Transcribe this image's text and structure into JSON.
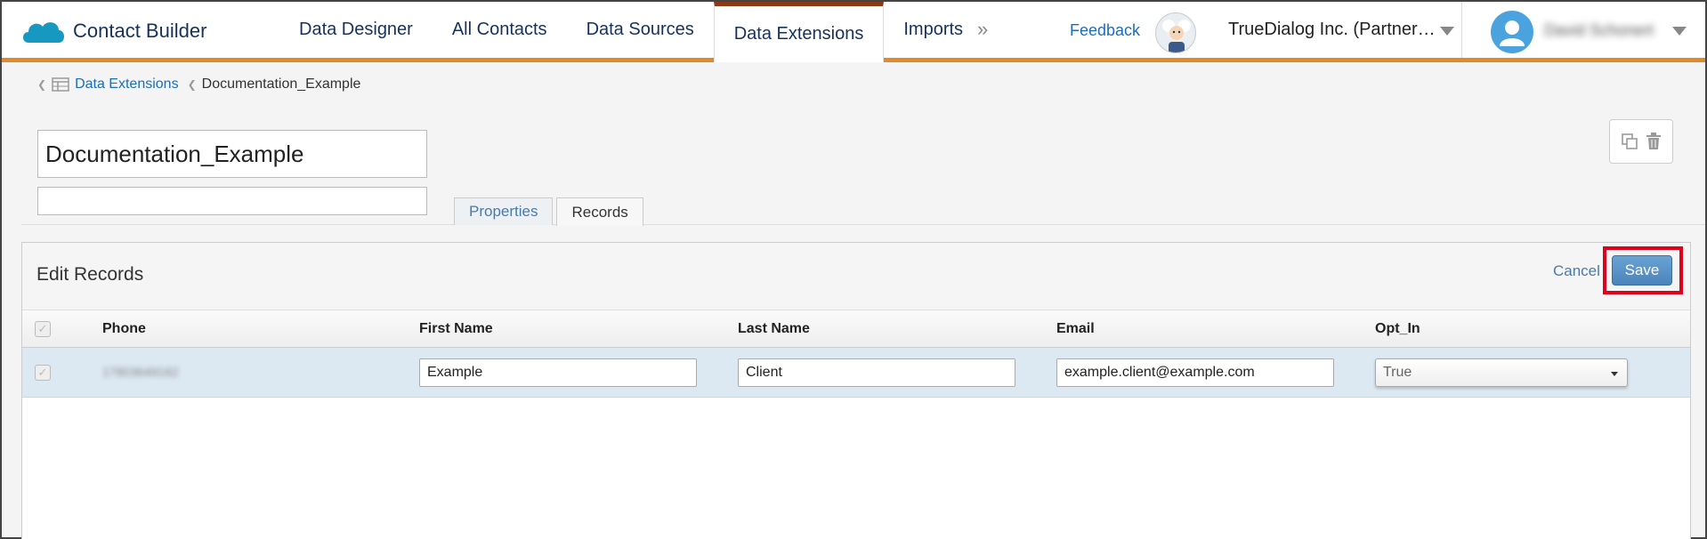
{
  "header": {
    "app_title": "Contact Builder",
    "nav": [
      {
        "label": "Data Designer",
        "active": false
      },
      {
        "label": "All Contacts",
        "active": false
      },
      {
        "label": "Data Sources",
        "active": false
      },
      {
        "label": "Data Extensions",
        "active": true
      },
      {
        "label": "Imports",
        "active": false
      }
    ],
    "more_glyph": "»",
    "feedback_label": "Feedback",
    "org_name": "TrueDialog Inc. (Partner…",
    "user_name": "David Schonert",
    "accent_color": "#e08a2e",
    "active_tab_color": "#8b3a16",
    "brand_color": "#1798c1"
  },
  "breadcrumb": {
    "parent": "Data Extensions",
    "current": "Documentation_Example"
  },
  "extension": {
    "name": "Documentation_Example",
    "description": ""
  },
  "tabs": [
    {
      "label": "Properties",
      "active": false
    },
    {
      "label": "Records",
      "active": true
    }
  ],
  "panel": {
    "title": "Edit Records",
    "cancel_label": "Cancel",
    "save_label": "Save",
    "highlight_color": "#e0001b"
  },
  "grid": {
    "columns": [
      "Phone",
      "First Name",
      "Last Name",
      "Email",
      "Opt_In"
    ],
    "rows": [
      {
        "phone": "17803649162",
        "first_name": "Example",
        "last_name": "Client",
        "email": "example.client@example.com",
        "opt_in": "True"
      }
    ]
  }
}
